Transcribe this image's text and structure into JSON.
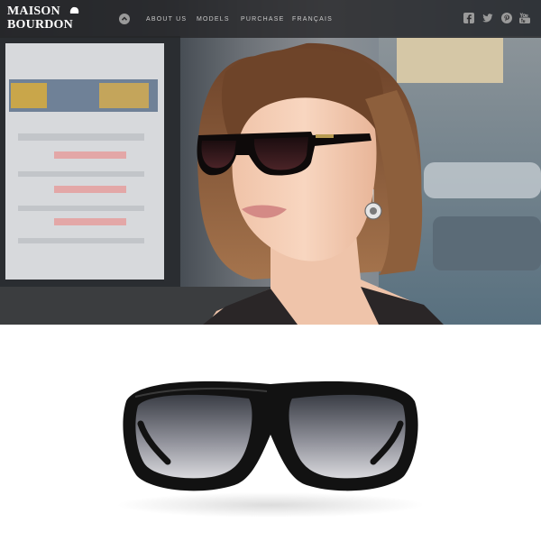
{
  "brand": {
    "logo_line1": "MAISON",
    "logo_line2": "BOURDON"
  },
  "nav": {
    "items": [
      {
        "label": "About us"
      },
      {
        "label": "Models"
      },
      {
        "label": "Purchase"
      },
      {
        "label": "Français"
      }
    ]
  },
  "icons": {
    "home": "chevron-up-circle-icon",
    "social": [
      "facebook-icon",
      "twitter-icon",
      "pinterest-icon",
      "youtube-icon"
    ]
  },
  "colors": {
    "nav_background": "#262628",
    "nav_text": "#c9c9c9",
    "icon_gray": "#9a9a9a",
    "frame_black": "#111111"
  }
}
